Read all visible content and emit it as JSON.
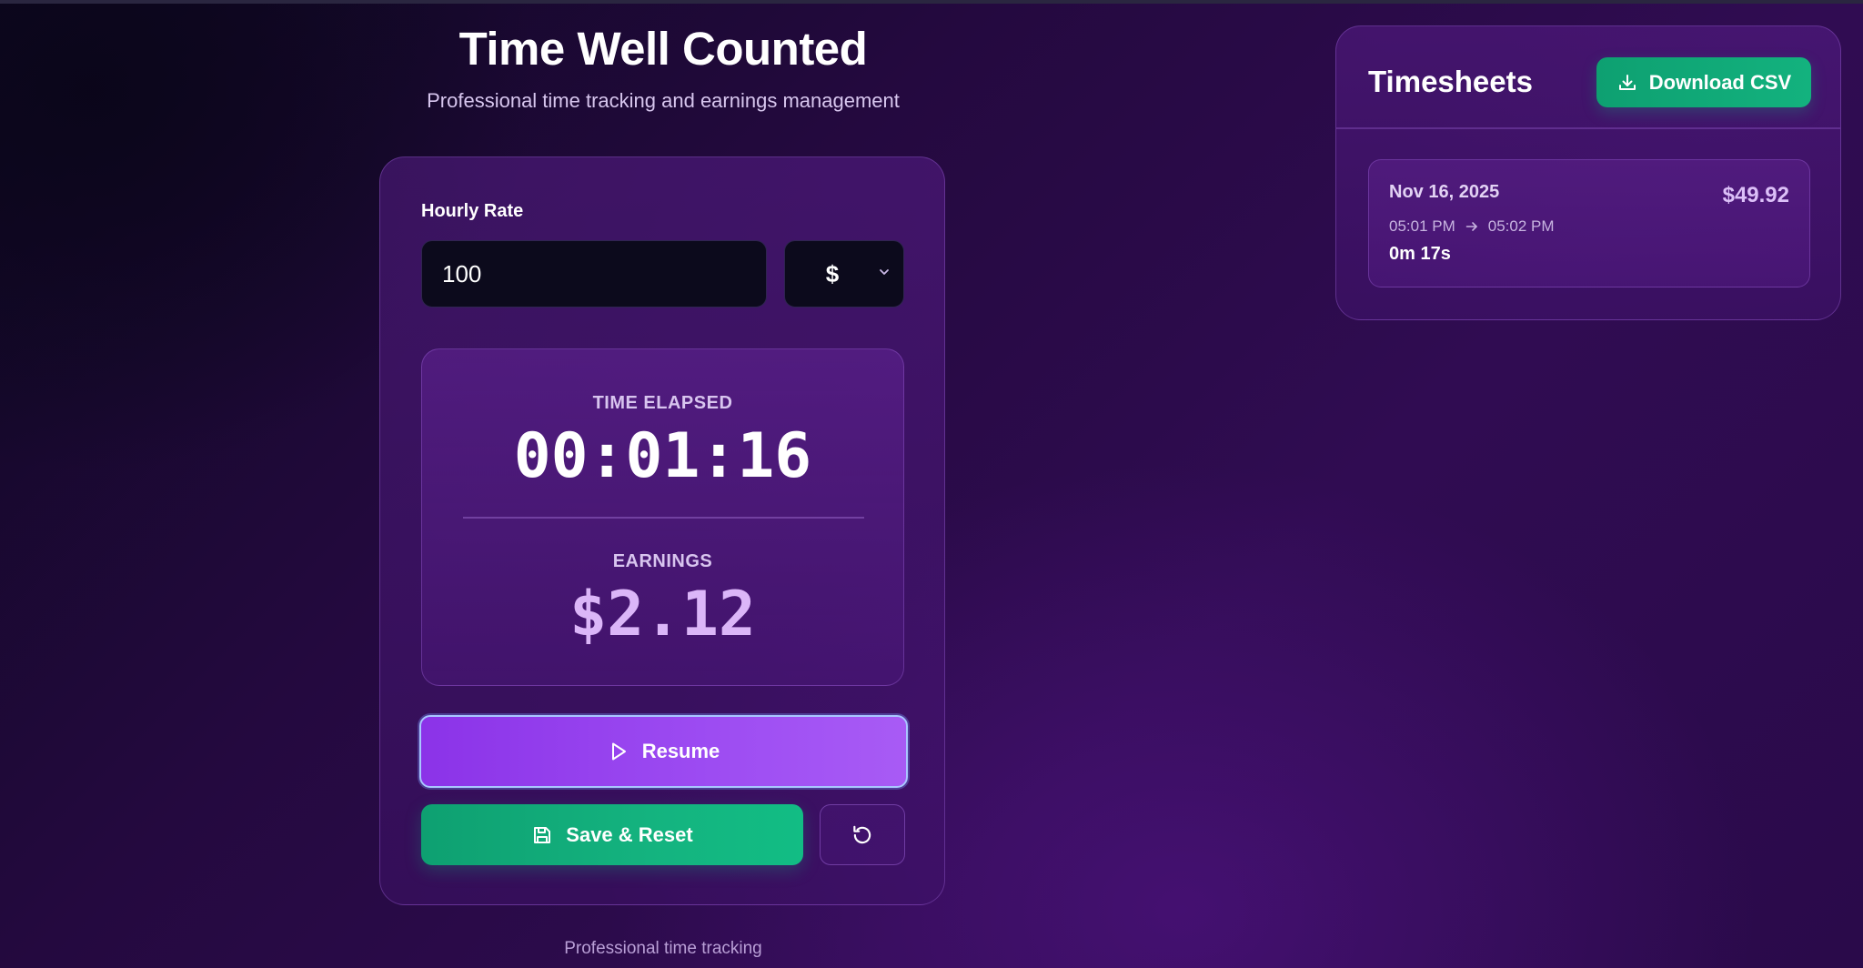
{
  "header": {
    "title": "Time Well Counted",
    "subtitle": "Professional time tracking and earnings management"
  },
  "tracker": {
    "rate_label": "Hourly Rate",
    "rate_value": "100",
    "currency": "$",
    "elapsed_label": "TIME ELAPSED",
    "elapsed_value": "00:01:16",
    "earnings_label": "EARNINGS",
    "earnings_value": "$2.12",
    "resume_label": "Resume",
    "save_label": "Save & Reset"
  },
  "footer": {
    "text": "Professional time tracking"
  },
  "timesheets": {
    "title": "Timesheets",
    "download_label": "Download CSV",
    "entries": [
      {
        "date": "Nov 16, 2025",
        "start": "05:01 PM",
        "end": "05:02 PM",
        "duration": "0m 17s",
        "amount": "$49.92"
      }
    ]
  },
  "icons": {
    "resume": "play-icon",
    "save": "save-icon",
    "reset": "rotate-ccw-icon",
    "download": "download-icon",
    "currency": "chevron-down-icon",
    "time_range": "arrow-right-icon"
  },
  "colors": {
    "primary": "#9d4cf2",
    "success": "#14b37f",
    "earnings": "#dbb6f8"
  }
}
